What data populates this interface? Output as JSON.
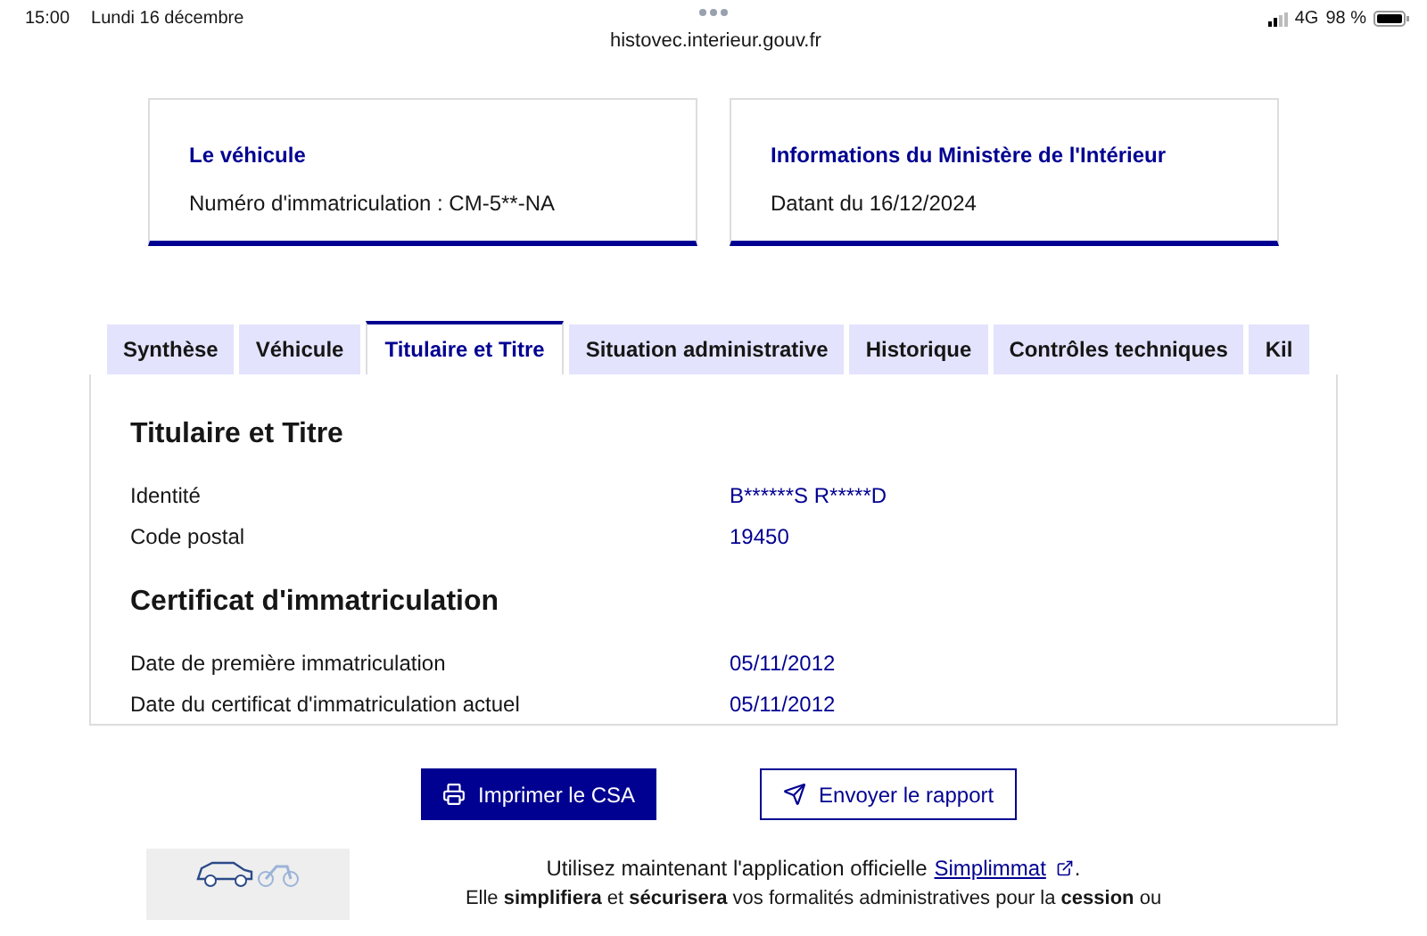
{
  "status_bar": {
    "time": "15:00",
    "date": "Lundi 16 décembre",
    "network": "4G",
    "battery": "98 %"
  },
  "address_bar": {
    "url": "histovec.interieur.gouv.fr"
  },
  "cards": [
    {
      "title": "Le véhicule",
      "text": "Numéro d'immatriculation : CM-5**-NA"
    },
    {
      "title": "Informations du Ministère de l'Intérieur",
      "text": "Datant du 16/12/2024"
    }
  ],
  "tabs": [
    {
      "label": "Synthèse",
      "selected": false
    },
    {
      "label": "Véhicule",
      "selected": false
    },
    {
      "label": "Titulaire et Titre",
      "selected": true
    },
    {
      "label": "Situation administrative",
      "selected": false
    },
    {
      "label": "Historique",
      "selected": false
    },
    {
      "label": "Contrôles techniques",
      "selected": false
    },
    {
      "label": "Kil",
      "selected": false
    }
  ],
  "sections": [
    {
      "title": "Titulaire et Titre",
      "rows": [
        {
          "label": "Identité",
          "value": "B******S R*****D"
        },
        {
          "label": "Code postal",
          "value": "19450"
        }
      ]
    },
    {
      "title": "Certificat d'immatriculation",
      "rows": [
        {
          "label": "Date de première immatriculation",
          "value": "05/11/2012"
        },
        {
          "label": "Date du certificat d'immatriculation actuel",
          "value": "05/11/2012"
        }
      ]
    }
  ],
  "buttons": [
    {
      "label": "Imprimer le CSA",
      "kind": "primary"
    },
    {
      "label": "Envoyer le rapport",
      "kind": "secondary"
    }
  ],
  "promo": {
    "text": "Utilisez maintenant l'application officielle",
    "link": "Simplimmat",
    "end": ".",
    "text_2": "Elle **simplifiera** et **sécurisera** vos formalités administratives pour la **cession** ou"
  }
}
